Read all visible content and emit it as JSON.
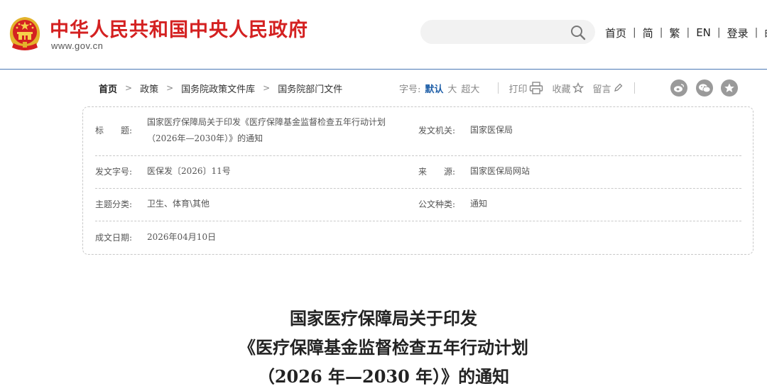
{
  "header": {
    "site_title": "中华人民共和国中央人民政府",
    "site_domain": "www.gov.cn",
    "search_placeholder": "",
    "nav": [
      "首页",
      "简",
      "繁",
      "EN",
      "登录",
      "邮"
    ],
    "nav_separator": "|"
  },
  "breadcrumb": {
    "items": [
      "首页",
      "政策",
      "国务院政策文件库",
      "国务院部门文件"
    ],
    "separator": ">"
  },
  "toolbar": {
    "font_size_label": "字号:",
    "font_size_options": [
      "默认",
      "大",
      "超大"
    ],
    "print_label": "打印",
    "favorite_label": "收藏",
    "comment_label": "留言",
    "accent_color": "#1f5fa8"
  },
  "share": {
    "icons": [
      "weibo-icon",
      "wechat-icon",
      "qzone-icon"
    ]
  },
  "document_info": {
    "title_label": "标　　题:",
    "title_value_line1": "国家医疗保障局关于印发《医疗保障基金监督检查五年行动计划",
    "title_value_line2": "（2026年—2030年）》的通知",
    "issuer_label": "发文机关:",
    "issuer_value": "国家医保局",
    "doc_number_label": "发文字号:",
    "doc_number_value": "医保发〔2026〕11号",
    "source_label": "来　　源:",
    "source_value": "国家医保局网站",
    "category_label": "主题分类:",
    "category_value": "卫生、体育\\其他",
    "doc_type_label": "公文种类:",
    "doc_type_value": "通知",
    "date_label": "成文日期:",
    "date_value": "2026年04月10日"
  },
  "article": {
    "title_line1": "国家医疗保障局关于印发",
    "title_line2": "《医疗保障基金监督检查五年行动计划",
    "title_line3": "（2026 年—2030 年）》的通知"
  },
  "colors": {
    "brand_red": "#d42121",
    "header_rule": "#4a78b5"
  }
}
